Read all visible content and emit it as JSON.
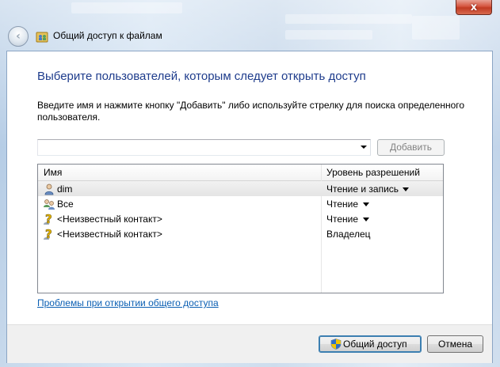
{
  "window": {
    "title": "Общий доступ к файлам",
    "close_label": "x",
    "back_label": "‹",
    "icons": {
      "back": "back-arrow-icon",
      "title": "users-share-icon",
      "close": "close-icon"
    }
  },
  "dialog": {
    "heading": "Выберите пользователей, которым следует открыть доступ",
    "instructions": "Введите имя и нажмите кнопку \"Добавить\" либо используйте стрелку для поиска определенного пользователя.",
    "user_input": {
      "value": "",
      "placeholder": ""
    },
    "add_button": "Добавить",
    "add_enabled": false
  },
  "table": {
    "columns": [
      "Имя",
      "Уровень разрешений"
    ],
    "rows": [
      {
        "name": "dim",
        "permission": "Чтение и запись",
        "icon": "user-icon",
        "has_dropdown": true,
        "selected": true
      },
      {
        "name": "Все",
        "permission": "Чтение",
        "icon": "group-icon",
        "has_dropdown": true,
        "selected": false
      },
      {
        "name": "<Неизвестный контакт>",
        "permission": "Чтение",
        "icon": "unknown-contact-icon",
        "has_dropdown": true,
        "selected": false
      },
      {
        "name": "<Неизвестный контакт>",
        "permission": "Владелец",
        "icon": "unknown-contact-icon",
        "has_dropdown": false,
        "selected": false
      }
    ]
  },
  "links": {
    "help": "Проблемы при открытии общего доступа"
  },
  "footer": {
    "share_button": "Общий доступ",
    "cancel_button": "Отмена",
    "icons": {
      "share": "uac-shield-icon"
    }
  },
  "colors": {
    "heading": "#1e3c8c",
    "link": "#0b5fb3",
    "close": "#c03a22"
  }
}
